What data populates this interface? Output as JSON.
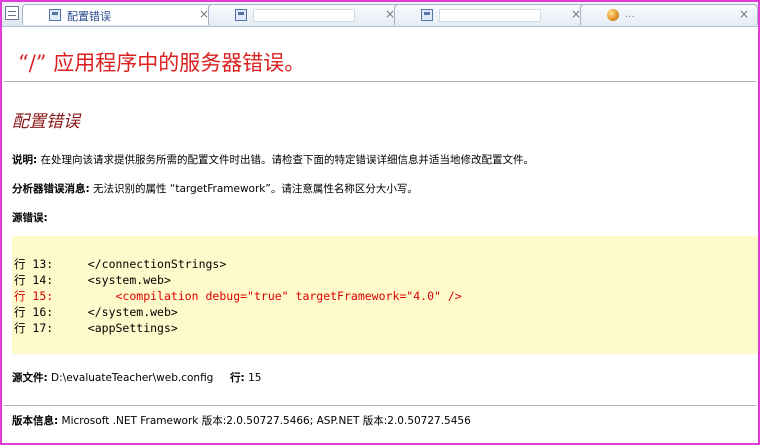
{
  "tabs": [
    {
      "label": "配置错误",
      "active": true,
      "close": "×"
    },
    {
      "label": "",
      "active": false,
      "close": "×"
    },
    {
      "label": "",
      "active": false,
      "close": "×"
    },
    {
      "label": "...",
      "active": false,
      "close": "×"
    }
  ],
  "page": {
    "title": "“/” 应用程序中的服务器错误。",
    "heading": "配置错误",
    "description_label": "说明:",
    "description_text": "在处理向该请求提供服务所需的配置文件时出错。请检查下面的特定错误详细信息并适当地修改配置文件。",
    "parser_label": "分析器错误消息:",
    "parser_text": "无法识别的属性 “targetFramework”。请注意属性名称区分大小写。",
    "source_error_label": "源错误:",
    "code_lines": [
      {
        "text": "行 13:     </connectionStrings>",
        "error": false
      },
      {
        "text": "行 14:     <system.web>",
        "error": false
      },
      {
        "text": "行 15:         <compilation debug=\"true\" targetFramework=\"4.0\" />",
        "error": true
      },
      {
        "text": "行 16:     </system.web>",
        "error": false
      },
      {
        "text": "行 17:     <appSettings>",
        "error": false
      }
    ],
    "source_file_label": "源文件:",
    "source_file_value": "D:\\evaluateTeacher\\web.config",
    "line_label": "行:",
    "line_value": "15",
    "version_label": "版本信息:",
    "version_text": "Microsoft .NET Framework 版本:2.0.50727.5466; ASP.NET 版本:2.0.50727.5456"
  }
}
